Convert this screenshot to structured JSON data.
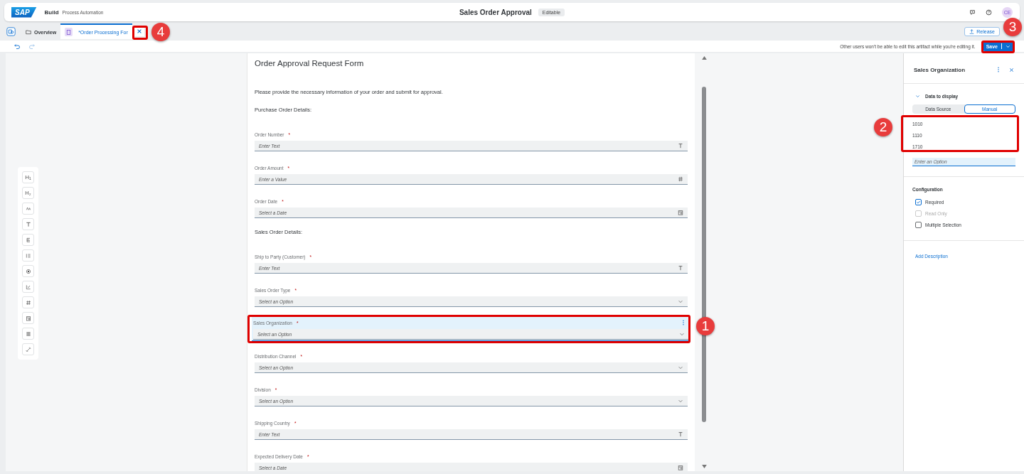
{
  "header": {
    "logo": "SAP",
    "product": "Build",
    "subtitle": "Process Automation",
    "title": "Sales Order Approval",
    "status": "Editable",
    "avatar": "CE"
  },
  "tabs": [
    {
      "kind": "overview",
      "label": "Overview",
      "selected": false
    },
    {
      "kind": "form",
      "label": "*Order Processing For",
      "selected": true
    }
  ],
  "release": "Release",
  "notice": "Other users won't be able to edit this artifact while you're editing it.",
  "save": "Save",
  "palette": [
    {
      "kind": "h1",
      "label": "H₁"
    },
    {
      "kind": "h2",
      "label": "H₂"
    },
    {
      "kind": "para"
    },
    {
      "kind": "text"
    },
    {
      "kind": "textarea"
    },
    {
      "kind": "list"
    },
    {
      "kind": "radio"
    },
    {
      "kind": "checkbox"
    },
    {
      "kind": "number"
    },
    {
      "kind": "date"
    },
    {
      "kind": "table"
    },
    {
      "kind": "link"
    }
  ],
  "form": {
    "title": "Order Approval Request Form",
    "items": [
      {
        "kind": "paragraph",
        "text": "Please provide the necessary information of your order and submit for approval."
      },
      {
        "kind": "subheading",
        "text": "Purchase Order Details:"
      },
      {
        "kind": "text-field",
        "label": "Order Number",
        "mark": "*",
        "placeholder": "Enter Text",
        "selected": false
      },
      {
        "kind": "number-field",
        "label": "Order Amount",
        "mark": "*",
        "placeholder": "Enter a Value",
        "selected": false
      },
      {
        "kind": "date-field",
        "label": "Order Date",
        "mark": "*",
        "placeholder": "Select a Date",
        "selected": false
      },
      {
        "kind": "subheading",
        "text": "Sales Order Details:"
      },
      {
        "kind": "text-field",
        "label": "Ship to Party (Customer)",
        "mark": "*",
        "placeholder": "Enter Text",
        "selected": false
      },
      {
        "kind": "select-field",
        "label": "Sales Order Type",
        "mark": "*",
        "placeholder": "Select an Option",
        "selected": false
      },
      {
        "kind": "select-field",
        "label": "Sales Organization",
        "mark": "*",
        "placeholder": "Select an Option",
        "selected": true
      },
      {
        "kind": "select-field",
        "label": "Distribution Channel",
        "mark": "*",
        "placeholder": "Select an Option",
        "selected": false
      },
      {
        "kind": "select-field",
        "label": "Division",
        "mark": "*",
        "placeholder": "Select an Option",
        "selected": false
      },
      {
        "kind": "text-field",
        "label": "Shipping Country",
        "mark": "*",
        "placeholder": "Enter Text",
        "selected": false
      },
      {
        "kind": "date-field",
        "label": "Expected Delivery Date",
        "mark": "*",
        "placeholder": "Select a Date",
        "selected": false
      }
    ]
  },
  "panel": {
    "title": "Sales Organization",
    "section": "Data to display",
    "expanded": true,
    "segments": [
      {
        "label": "Data Source",
        "selected": false
      },
      {
        "label": "Manual",
        "selected": true
      }
    ],
    "options": [
      "1010",
      "1110",
      "1710"
    ],
    "option_placeholder": "Enter an Option",
    "config_title": "Configuration",
    "checks": [
      {
        "label": "Required",
        "checked": true,
        "disabled": false
      },
      {
        "label": "Read Only",
        "checked": false,
        "disabled": true
      },
      {
        "label": "Multiple Selection",
        "checked": false,
        "disabled": false
      }
    ],
    "link": "Add Description"
  },
  "callouts": [
    {
      "label": "1"
    },
    {
      "label": "2"
    },
    {
      "label": "3"
    },
    {
      "label": "4"
    }
  ]
}
